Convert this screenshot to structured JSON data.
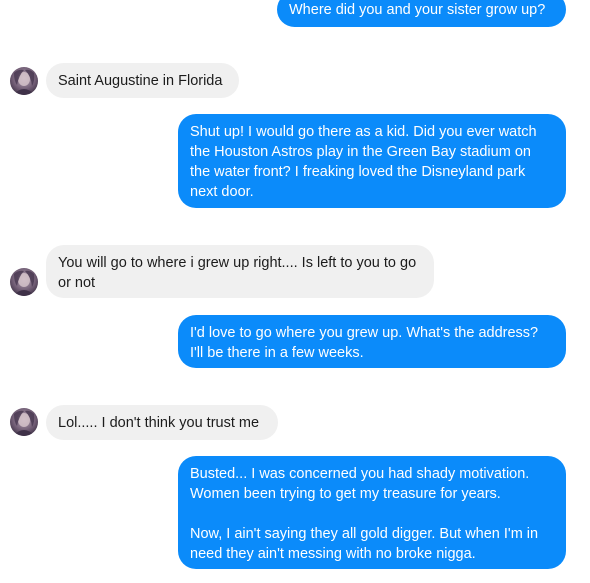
{
  "conversation": {
    "messages": [
      {
        "sender": "me",
        "text": "Where did you and your sister grow up?"
      },
      {
        "sender": "them",
        "text": "Saint Augustine in Florida"
      },
      {
        "sender": "me",
        "text": "Shut up! I would go there as a kid. Did you ever watch the Houston Astros play in the Green Bay stadium on the water front? I freaking loved the Disneyland park next door."
      },
      {
        "sender": "them",
        "text": "You will go to where i grew up right.... Is left to you to go or not"
      },
      {
        "sender": "me",
        "text": "I'd love to go where you grew up. What's the address? I'll be there in a few weeks."
      },
      {
        "sender": "them",
        "text": "Lol..... I don't think you trust me"
      },
      {
        "sender": "me",
        "text": "Busted... I was concerned you had shady motivation. Women been trying to get my treasure for years.\n\nNow, I ain't saying they all gold digger. But when I'm in need they ain't messing with no broke nigga."
      }
    ]
  },
  "colors": {
    "sent_bubble": "#0b8bfa",
    "received_bubble": "#f0f0f0",
    "sent_text": "#ffffff",
    "received_text": "#1c1c1c"
  },
  "icons": {
    "contact_avatar": "contact-avatar-icon"
  }
}
